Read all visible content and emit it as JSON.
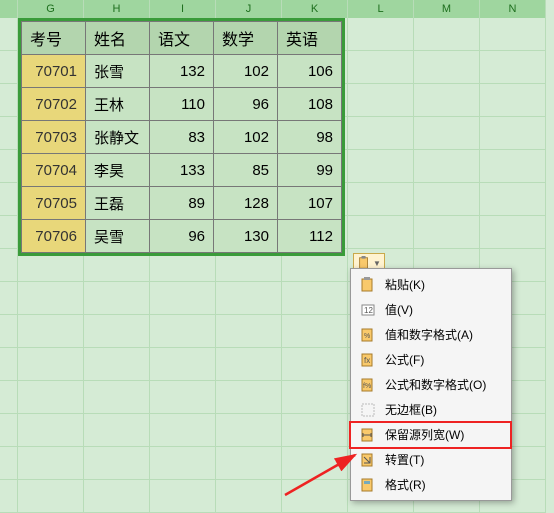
{
  "columns": [
    "G",
    "H",
    "I",
    "J",
    "K",
    "L",
    "M",
    "N"
  ],
  "table": {
    "headers": [
      "考号",
      "姓名",
      "语文",
      "数学",
      "英语"
    ],
    "rows": [
      [
        "70701",
        "张雪",
        "132",
        "102",
        "106"
      ],
      [
        "70702",
        "王林",
        "110",
        "96",
        "108"
      ],
      [
        "70703",
        "张静文",
        "83",
        "102",
        "98"
      ],
      [
        "70704",
        "李昊",
        "133",
        "85",
        "99"
      ],
      [
        "70705",
        "王磊",
        "89",
        "128",
        "107"
      ],
      [
        "70706",
        "吴雪",
        "96",
        "130",
        "112"
      ]
    ]
  },
  "menu": {
    "items": [
      {
        "label": "粘贴(K)"
      },
      {
        "label": "值(V)"
      },
      {
        "label": "值和数字格式(A)"
      },
      {
        "label": "公式(F)"
      },
      {
        "label": "公式和数字格式(O)"
      },
      {
        "label": "无边框(B)"
      },
      {
        "label": "保留源列宽(W)"
      },
      {
        "label": "转置(T)"
      },
      {
        "label": "格式(R)"
      }
    ]
  },
  "chart_data": {
    "type": "table",
    "title": "",
    "columns": [
      "考号",
      "姓名",
      "语文",
      "数学",
      "英语"
    ],
    "rows": [
      [
        70701,
        "张雪",
        132,
        102,
        106
      ],
      [
        70702,
        "王林",
        110,
        96,
        108
      ],
      [
        70703,
        "张静文",
        83,
        102,
        98
      ],
      [
        70704,
        "李昊",
        133,
        85,
        99
      ],
      [
        70705,
        "王磊",
        89,
        128,
        107
      ],
      [
        70706,
        "吴雪",
        96,
        130,
        112
      ]
    ]
  }
}
